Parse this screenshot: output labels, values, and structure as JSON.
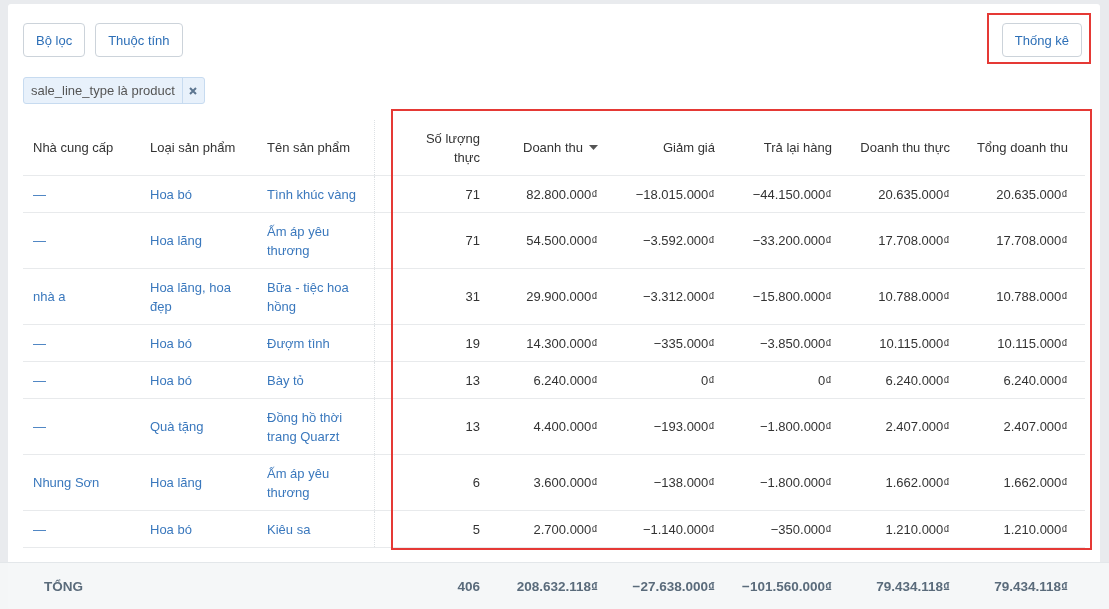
{
  "toolbar": {
    "buttons": [
      {
        "label": "Bộ lọc"
      },
      {
        "label": "Thuộc tính"
      }
    ],
    "stats_button": {
      "label": "Thống kê"
    }
  },
  "filter_chips": [
    {
      "label": "sale_line_type là product"
    }
  ],
  "table": {
    "columns": [
      {
        "label": "Nhà cung cấp",
        "kind": "text",
        "sorted": false
      },
      {
        "label": "Loại sản phẩm",
        "kind": "text",
        "sorted": false
      },
      {
        "label": "Tên sản phẩm",
        "kind": "text",
        "sorted": false
      },
      {
        "label": "Số lượng thực",
        "kind": "number",
        "wrap": true,
        "sorted": false
      },
      {
        "label": "Doanh thu",
        "kind": "number",
        "sorted": true
      },
      {
        "label": "Giảm giá",
        "kind": "number",
        "sorted": false
      },
      {
        "label": "Trả lại hàng",
        "kind": "number",
        "sorted": false
      },
      {
        "label": "Doanh thu thực",
        "kind": "number",
        "sorted": false
      },
      {
        "label": "Tổng doanh thu",
        "kind": "number",
        "sorted": false
      }
    ],
    "rows": [
      {
        "cells": [
          "—",
          "Hoa bó",
          "Tình khúc vàng",
          "71",
          "82.800.000₫",
          "−18.015.000₫",
          "−44.150.000₫",
          "20.635.000₫",
          "20.635.000₫"
        ]
      },
      {
        "cells": [
          "—",
          "Hoa lãng",
          "Ấm áp yêu thương",
          "71",
          "54.500.000₫",
          "−3.592.000₫",
          "−33.200.000₫",
          "17.708.000₫",
          "17.708.000₫"
        ]
      },
      {
        "cells": [
          "nhà a",
          "Hoa lãng, hoa đẹp",
          "Bữa - tiệc hoa hồng",
          "31",
          "29.900.000₫",
          "−3.312.000₫",
          "−15.800.000₫",
          "10.788.000₫",
          "10.788.000₫"
        ]
      },
      {
        "cells": [
          "—",
          "Hoa bó",
          "Đượm tình",
          "19",
          "14.300.000₫",
          "−335.000₫",
          "−3.850.000₫",
          "10.115.000₫",
          "10.115.000₫"
        ]
      },
      {
        "cells": [
          "—",
          "Hoa bó",
          "Bày tỏ",
          "13",
          "6.240.000₫",
          "0₫",
          "0₫",
          "6.240.000₫",
          "6.240.000₫"
        ]
      },
      {
        "cells": [
          "—",
          "Quà tặng",
          "Đồng hồ thời trang Quarzt",
          "13",
          "4.400.000₫",
          "−193.000₫",
          "−1.800.000₫",
          "2.407.000₫",
          "2.407.000₫"
        ]
      },
      {
        "cells": [
          "Nhung Sơn",
          "Hoa lãng",
          "Ấm áp yêu thương",
          "6",
          "3.600.000₫",
          "−138.000₫",
          "−1.800.000₫",
          "1.662.000₫",
          "1.662.000₫"
        ]
      },
      {
        "cells": [
          "—",
          "Hoa bó",
          "Kiêu sa",
          "5",
          "2.700.000₫",
          "−1.140.000₫",
          "−350.000₫",
          "1.210.000₫",
          "1.210.000₫"
        ]
      }
    ],
    "footer": {
      "label": "TỔNG",
      "values": [
        "406",
        "208.632.118₫",
        "−27.638.000₫",
        "−101.560.000₫",
        "79.434.118₫",
        "79.434.118₫"
      ]
    }
  }
}
